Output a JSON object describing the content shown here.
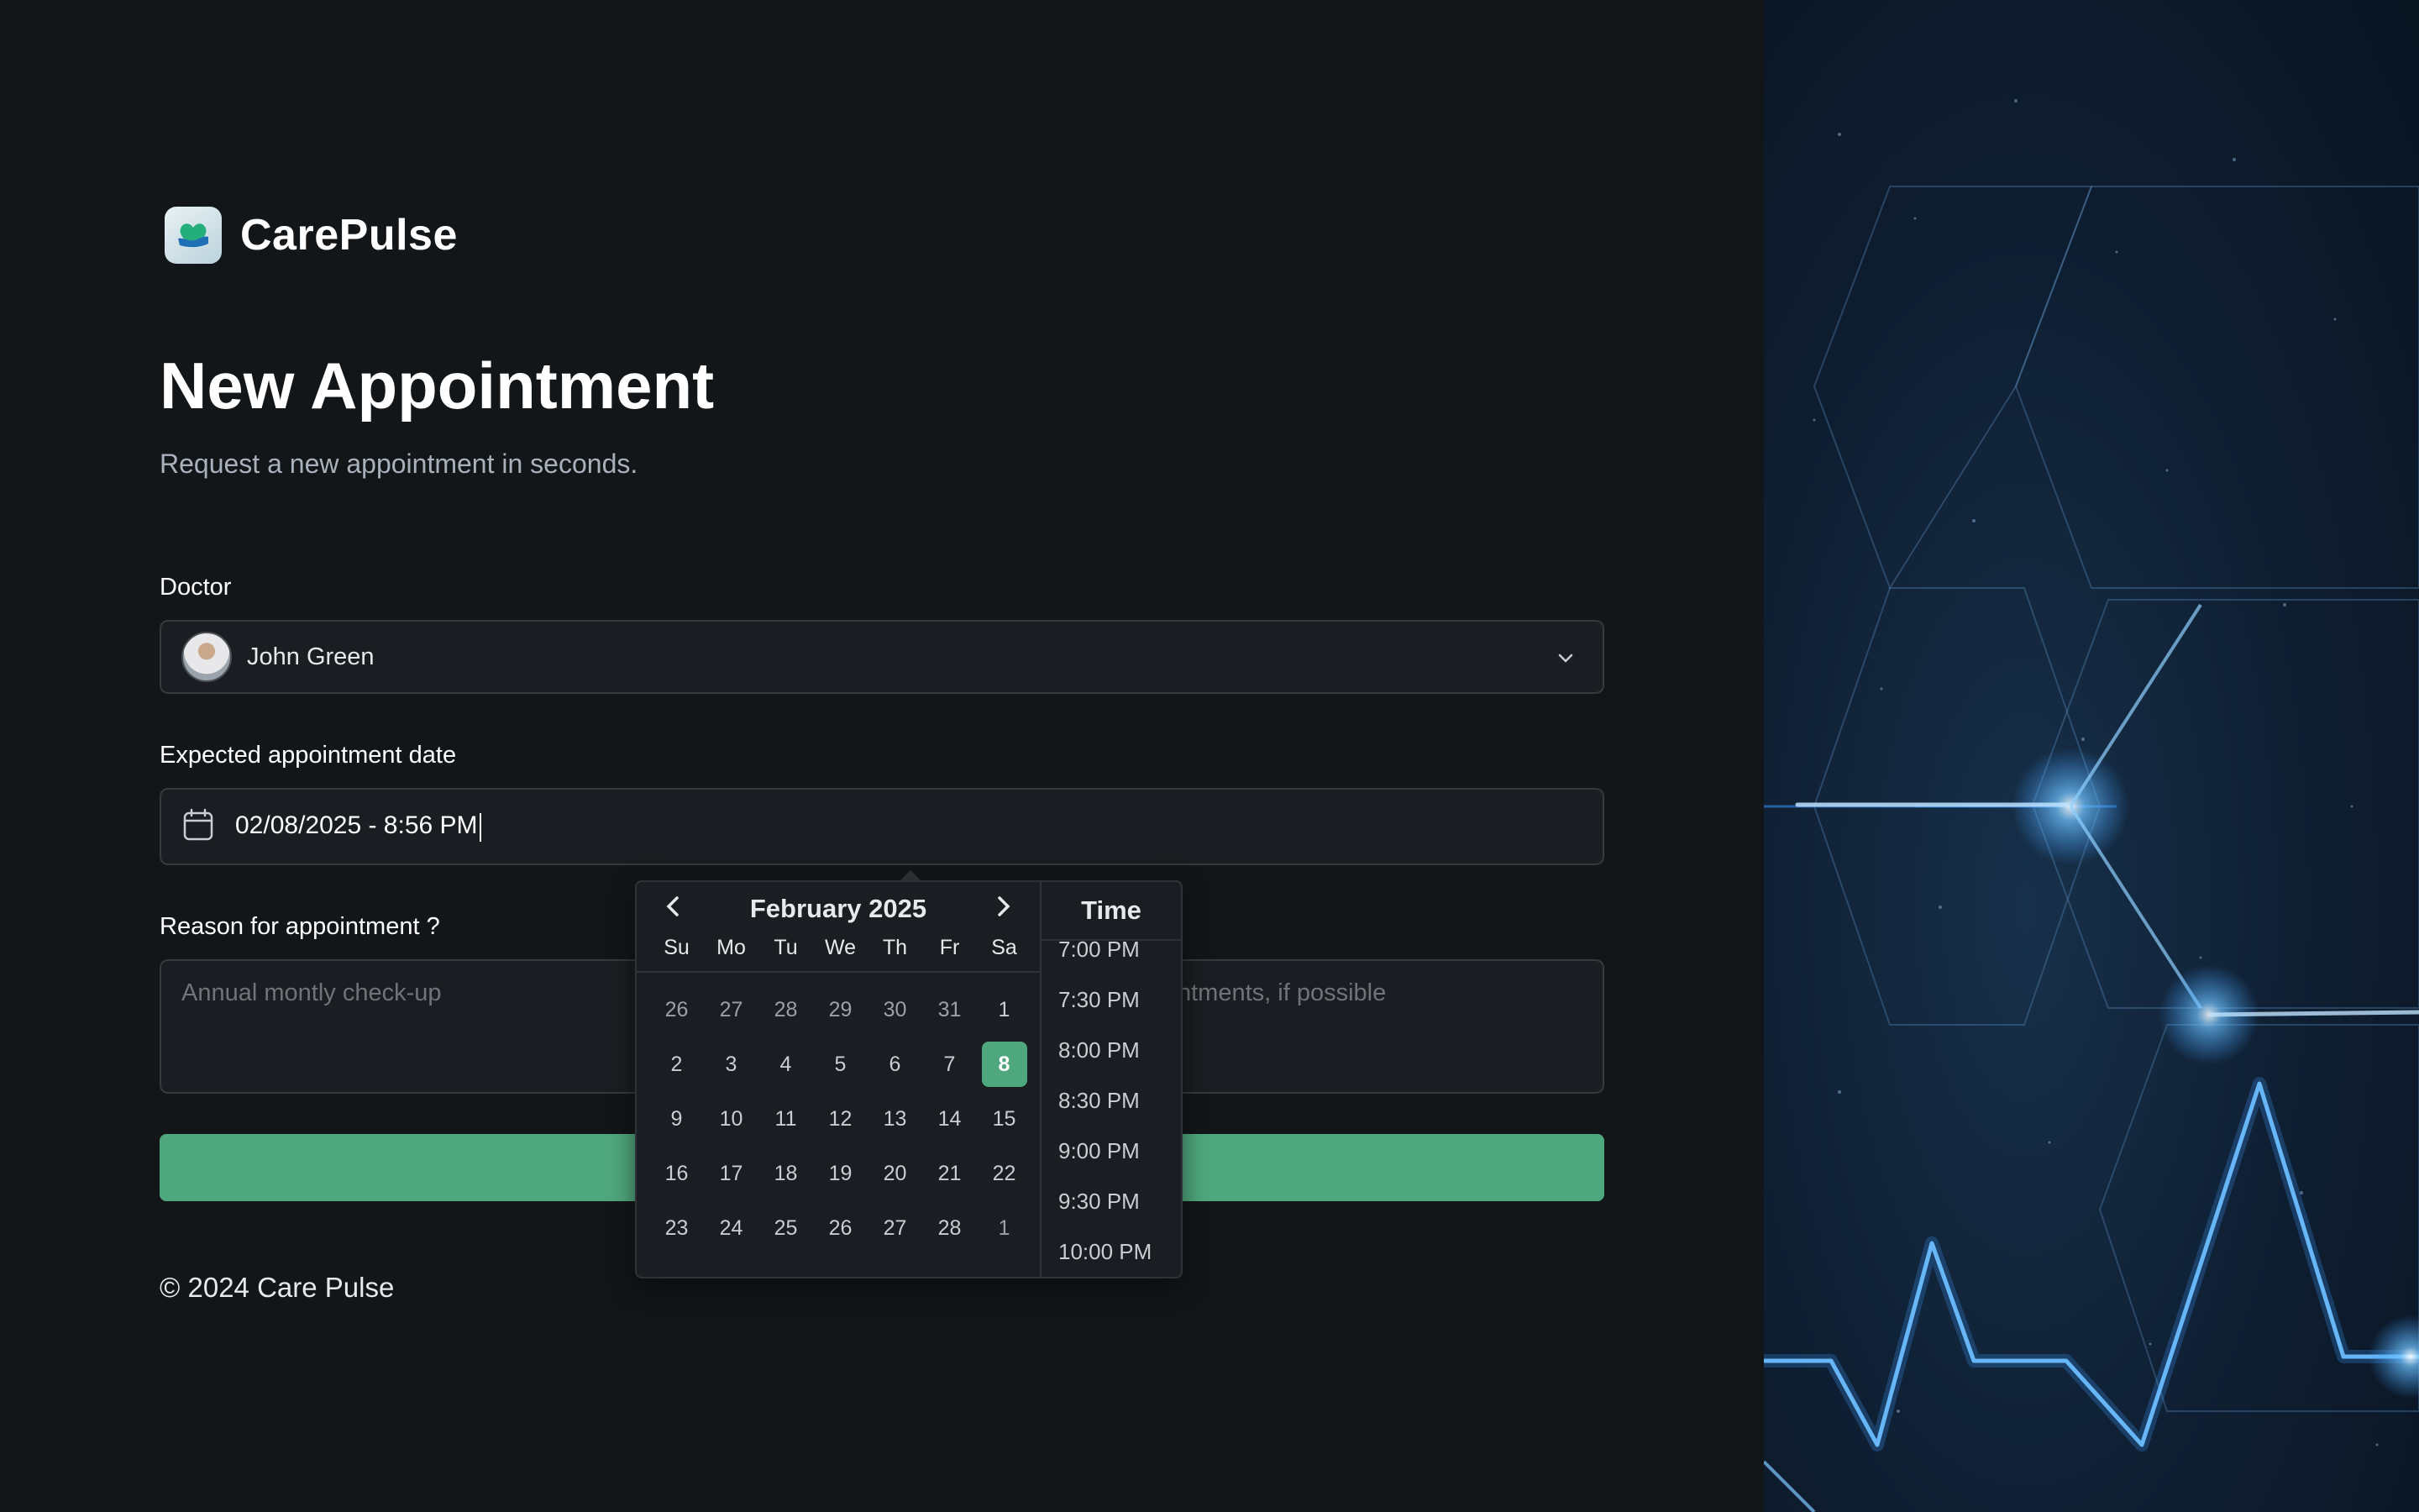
{
  "brand": {
    "name": "CarePulse"
  },
  "page": {
    "title": "New Appointment",
    "subtitle": "Request a new appointment in seconds."
  },
  "form": {
    "doctor_label": "Doctor",
    "doctor_value": "John Green",
    "date_label": "Expected appointment date",
    "date_value": "02/08/2025 - 8:56 PM",
    "reason_label": "Reason for appointment ?",
    "reason_placeholder": "Annual montly check-up",
    "notes_placeholder_visible": "ntments, if possible"
  },
  "datepicker": {
    "month_label": "February 2025",
    "weekdays": [
      "Su",
      "Mo",
      "Tu",
      "We",
      "Th",
      "Fr",
      "Sa"
    ],
    "weeks": [
      [
        "26",
        "27",
        "28",
        "29",
        "30",
        "31",
        "1"
      ],
      [
        "2",
        "3",
        "4",
        "5",
        "6",
        "7",
        "8"
      ],
      [
        "9",
        "10",
        "11",
        "12",
        "13",
        "14",
        "15"
      ],
      [
        "16",
        "17",
        "18",
        "19",
        "20",
        "21",
        "22"
      ],
      [
        "23",
        "24",
        "25",
        "26",
        "27",
        "28",
        "1"
      ]
    ],
    "selected_day": "8",
    "time_header": "Time",
    "times": [
      "7:00 PM",
      "7:30 PM",
      "8:00 PM",
      "8:30 PM",
      "9:00 PM",
      "9:30 PM",
      "10:00 PM"
    ]
  },
  "footer": {
    "copyright": "© 2024 Care Pulse"
  },
  "colors": {
    "background": "#131619",
    "input_bg": "#1a1d21",
    "border": "#363a3d",
    "accent_green": "#4fa77d",
    "text_muted": "#a9b1bb",
    "hero_glow": "#3b9cff"
  },
  "icons": {
    "logo": "heart-hand-logo-icon",
    "chevron": "chevron-down-icon",
    "calendar": "calendar-icon",
    "prev": "chevron-left-icon",
    "next": "chevron-right-icon"
  }
}
